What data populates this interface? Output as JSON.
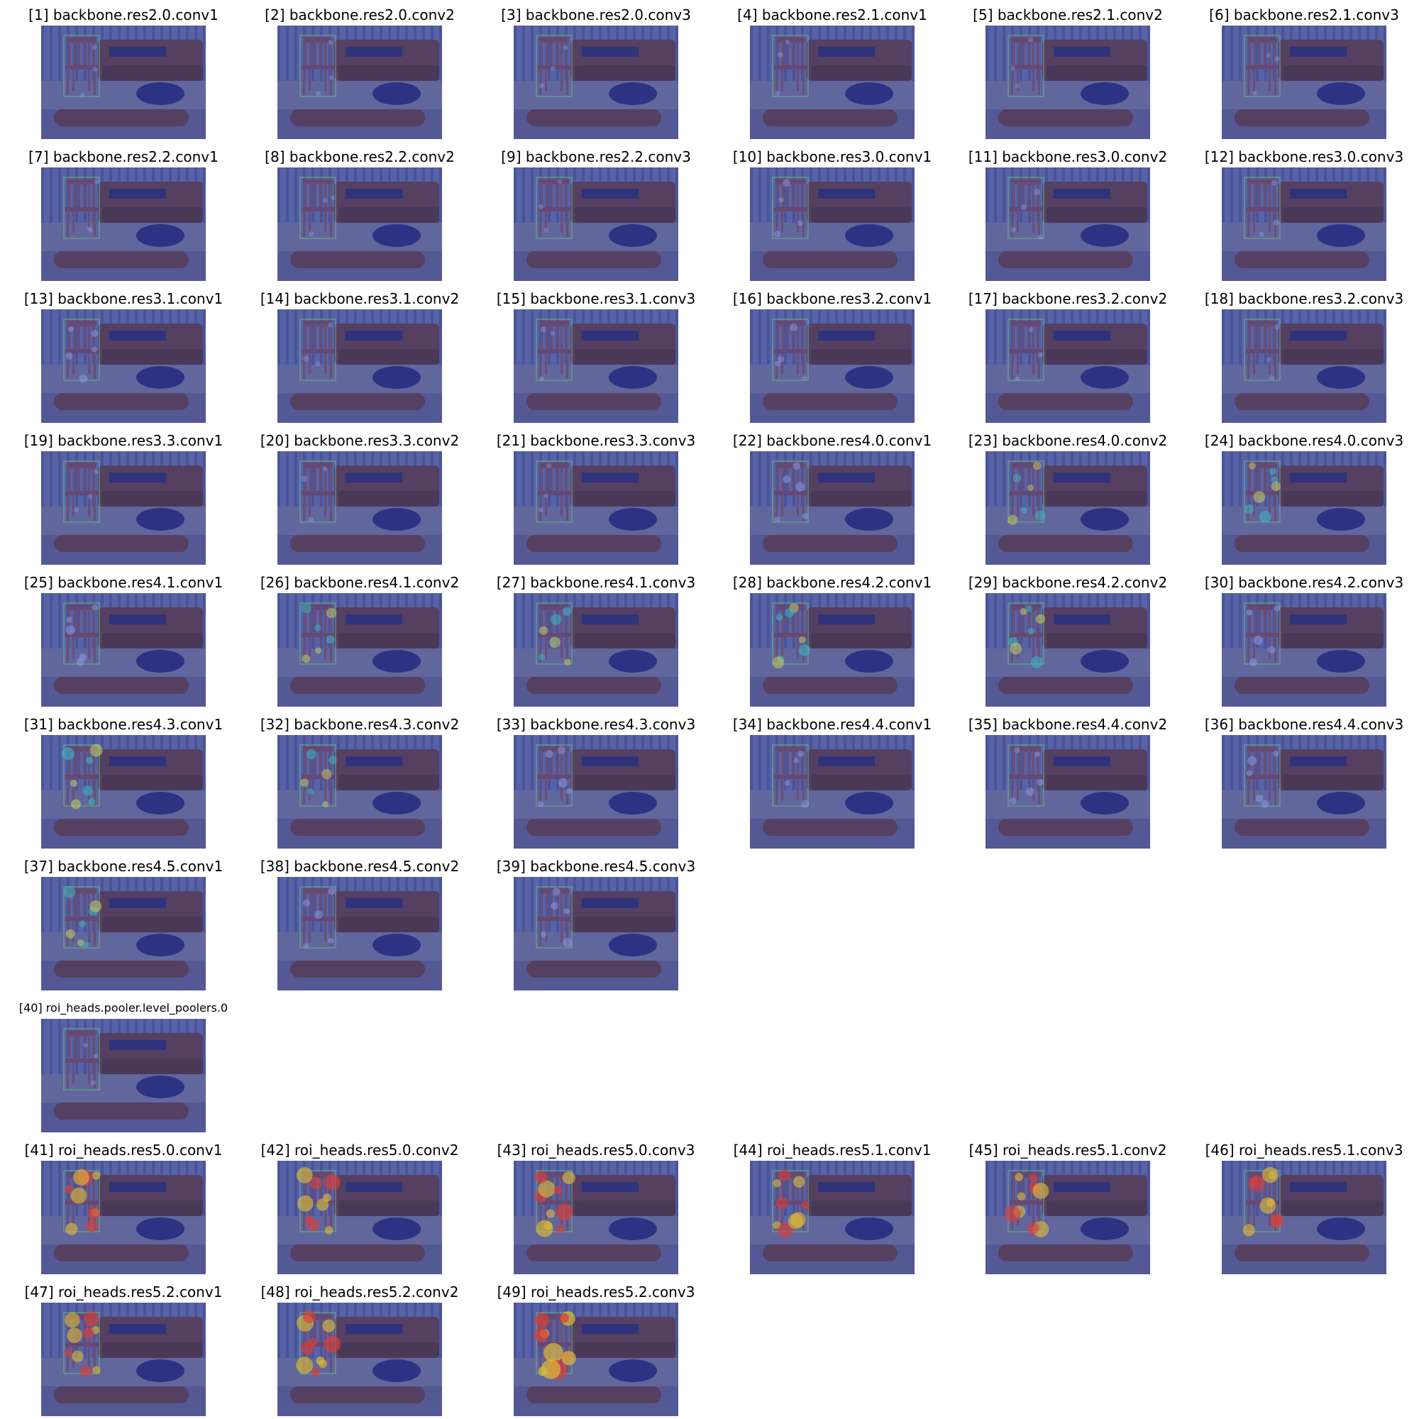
{
  "figure": {
    "panels": [
      {
        "title": "[1] backbone.res2.0.conv1",
        "heat": 0.05
      },
      {
        "title": "[2] backbone.res2.0.conv2",
        "heat": 0.05
      },
      {
        "title": "[3] backbone.res2.0.conv3",
        "heat": 0.05
      },
      {
        "title": "[4] backbone.res2.1.conv1",
        "heat": 0.08
      },
      {
        "title": "[5] backbone.res2.1.conv2",
        "heat": 0.05
      },
      {
        "title": "[6] backbone.res2.1.conv3",
        "heat": 0.05
      },
      {
        "title": "[7] backbone.res2.2.conv1",
        "heat": 0.05
      },
      {
        "title": "[8] backbone.res2.2.conv2",
        "heat": 0.05
      },
      {
        "title": "[9] backbone.res2.2.conv3",
        "heat": 0.05
      },
      {
        "title": "[10] backbone.res3.0.conv1",
        "heat": 0.2
      },
      {
        "title": "[11] backbone.res3.0.conv2",
        "heat": 0.15
      },
      {
        "title": "[12] backbone.res3.0.conv3",
        "heat": 0.12
      },
      {
        "title": "[13] backbone.res3.1.conv1",
        "heat": 0.25
      },
      {
        "title": "[14] backbone.res3.1.conv2",
        "heat": 0.08
      },
      {
        "title": "[15] backbone.res3.1.conv3",
        "heat": 0.08
      },
      {
        "title": "[16] backbone.res3.2.conv1",
        "heat": 0.2
      },
      {
        "title": "[17] backbone.res3.2.conv2",
        "heat": 0.08
      },
      {
        "title": "[18] backbone.res3.2.conv3",
        "heat": 0.05
      },
      {
        "title": "[19] backbone.res3.3.conv1",
        "heat": 0.05
      },
      {
        "title": "[20] backbone.res3.3.conv2",
        "heat": 0.1
      },
      {
        "title": "[21] backbone.res3.3.conv3",
        "heat": 0.05
      },
      {
        "title": "[22] backbone.res4.0.conv1",
        "heat": 0.3
      },
      {
        "title": "[23] backbone.res4.0.conv2",
        "heat": 0.35
      },
      {
        "title": "[24] backbone.res4.0.conv3",
        "heat": 0.45
      },
      {
        "title": "[25] backbone.res4.1.conv1",
        "heat": 0.3
      },
      {
        "title": "[26] backbone.res4.1.conv2",
        "heat": 0.35
      },
      {
        "title": "[27] backbone.res4.1.conv3",
        "heat": 0.4
      },
      {
        "title": "[28] backbone.res4.2.conv1",
        "heat": 0.45
      },
      {
        "title": "[29] backbone.res4.2.conv2",
        "heat": 0.45
      },
      {
        "title": "[30] backbone.res4.2.conv3",
        "heat": 0.3
      },
      {
        "title": "[31] backbone.res4.3.conv1",
        "heat": 0.5
      },
      {
        "title": "[32] backbone.res4.3.conv2",
        "heat": 0.35
      },
      {
        "title": "[33] backbone.res4.3.conv3",
        "heat": 0.3
      },
      {
        "title": "[34] backbone.res4.4.conv1",
        "heat": 0.2
      },
      {
        "title": "[35] backbone.res4.4.conv2",
        "heat": 0.25
      },
      {
        "title": "[36] backbone.res4.4.conv3",
        "heat": 0.3
      },
      {
        "title": "[37] backbone.res4.5.conv1",
        "heat": 0.45
      },
      {
        "title": "[38] backbone.res4.5.conv2",
        "heat": 0.25
      },
      {
        "title": "[39] backbone.res4.5.conv3",
        "heat": 0.3
      },
      {
        "title": "[40] roi_heads.pooler.level_poolers.0",
        "heat": 0.05,
        "small": true
      },
      {
        "title": "[41] roi_heads.res5.0.conv1",
        "heat": 0.7
      },
      {
        "title": "[42] roi_heads.res5.0.conv2",
        "heat": 0.7
      },
      {
        "title": "[43] roi_heads.res5.0.conv3",
        "heat": 0.75
      },
      {
        "title": "[44] roi_heads.res5.1.conv1",
        "heat": 0.65
      },
      {
        "title": "[45] roi_heads.res5.1.conv2",
        "heat": 0.7
      },
      {
        "title": "[46] roi_heads.res5.1.conv3",
        "heat": 0.7
      },
      {
        "title": "[47] roi_heads.res5.2.conv1",
        "heat": 0.65
      },
      {
        "title": "[48] roi_heads.res5.2.conv2",
        "heat": 0.75
      },
      {
        "title": "[49] roi_heads.res5.2.conv3",
        "heat": 0.9
      }
    ]
  }
}
